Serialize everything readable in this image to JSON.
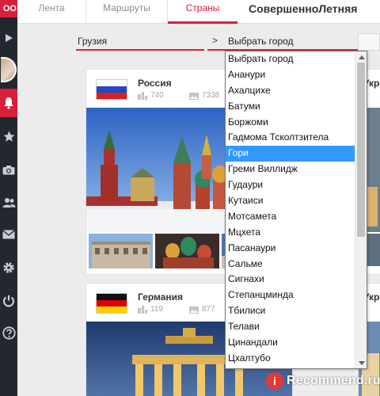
{
  "sidebar": {
    "logo_text": "OO",
    "icons": [
      "play-icon",
      "avatar",
      "bell-icon",
      "star-icon",
      "camera-icon",
      "friends-icon",
      "mail-icon",
      "gear-icon",
      "power-icon",
      "help-icon"
    ],
    "accent": "#d8203a",
    "bg": "#23282f"
  },
  "topbar": {
    "tabs": [
      {
        "label": "Лента"
      },
      {
        "label": "Маршруты"
      },
      {
        "label": "Страны"
      }
    ],
    "active_tab": "Страны",
    "site_title": "СовершенноЛетняя"
  },
  "filters": {
    "country_value": "Грузия",
    "arrow": ">",
    "city_value": "Выбрать город"
  },
  "dropdown": {
    "items": [
      "Выбрать город",
      "Ананури",
      "Ахалцихе",
      "Батуми",
      "Боржоми",
      "Гадмома Тсколтзитела",
      "Гори",
      "Греми Виллидж",
      "Гудаури",
      "Кутаиси",
      "Мотсамета",
      "Мцхета",
      "Пасанаури",
      "Сальме",
      "Сигнахи",
      "Степанцминда",
      "Тбилиси",
      "Телави",
      "Цинандали",
      "Цхалтубо"
    ],
    "selected": "Гори",
    "selected_color": "#3399ff"
  },
  "cards": [
    {
      "country": "Россия",
      "places": "740",
      "photos": "7338"
    },
    {
      "country": "Германия",
      "places": "119",
      "photos": "877"
    }
  ],
  "peek_cards": [
    {
      "title": "Укра"
    },
    {
      "title": "Укра"
    }
  ],
  "watermark": {
    "badge": "i",
    "text": "Recommend.ru"
  }
}
